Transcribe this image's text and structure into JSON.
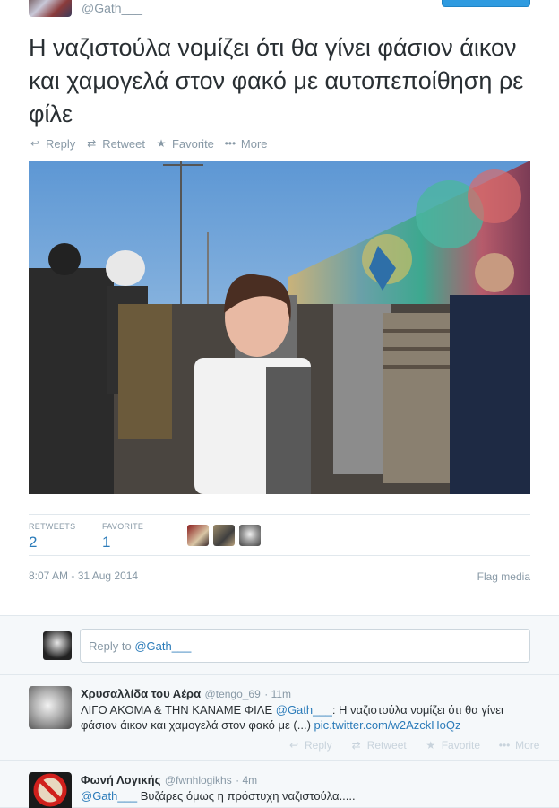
{
  "top": {
    "handle": "@Gath___"
  },
  "tweet": {
    "text": "Η ναζιστούλα νομίζει ότι θα γίνει φάσιον άικον και χαμογελά στον φακό με αυτοπεποίθηση ρε φίλε",
    "actions": {
      "reply": "Reply",
      "retweet": "Retweet",
      "favorite": "Favorite",
      "more": "More"
    },
    "stats": {
      "retweets_label": "RETWEETS",
      "retweets": "2",
      "favorites_label": "FAVORITE",
      "favorites": "1"
    },
    "timestamp": "8:07 AM - 31 Aug 2014",
    "flag_media": "Flag media"
  },
  "reply_box": {
    "prefix": "Reply to ",
    "mention": "@Gath___"
  },
  "replies": [
    {
      "name": "Χρυσαλλίδα του Αέρα",
      "handle": "@tengo_69",
      "time": "· 11m",
      "body_prefix": "ΛΙΓΟ ΑΚΟΜΑ & ΤΗΝ ΚΑΝΑΜΕ ΦΙΛΕ ",
      "mention": "@Gath___",
      "body_text": ": Η ναζιστούλα νομίζει ότι θα γίνει φάσιον άικον και χαμογελά στον φακό με (...) ",
      "link": "pic.twitter.com/w2AzckHoQz",
      "actions": {
        "reply": "Reply",
        "retweet": "Retweet",
        "favorite": "Favorite",
        "more": "More"
      }
    },
    {
      "name": "Φωνή Λογικής",
      "handle": "@fwnhlogikhs",
      "time": "· 4m",
      "mention": "@Gath___",
      "body_text": " Βυζάρες όμως η πρόστυχη ναζιστούλα....."
    }
  ],
  "colors": {
    "link": "#2b7bb9",
    "muted": "#8899a6",
    "text": "#292f33"
  },
  "icons": [
    "reply-icon",
    "retweet-icon",
    "star-icon",
    "more-dots-icon"
  ]
}
